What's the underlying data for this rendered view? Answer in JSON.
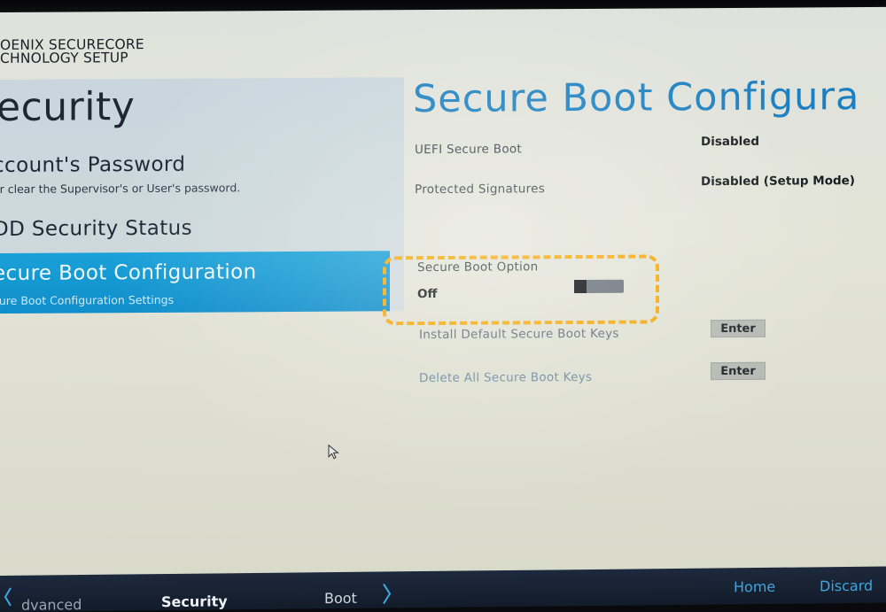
{
  "brand": {
    "line1": "OENIX SECURECORE",
    "line2": "CHNOLOGY SETUP"
  },
  "left_panel": {
    "title": "ecurity",
    "items": [
      {
        "label": "ccount's Password",
        "description": "or clear the Supervisor's or User's password."
      },
      {
        "label": "DD Security Status",
        "description": ""
      },
      {
        "label": "ecure Boot Configuration",
        "description": "cure Boot Configuration Settings",
        "selected": true
      }
    ]
  },
  "content": {
    "title": "Secure Boot Configura",
    "rows": [
      {
        "label": "UEFI Secure Boot",
        "value": "Disabled"
      },
      {
        "label": "Protected Signatures",
        "value": "Disabled (Setup Mode)"
      }
    ],
    "secure_boot_option": {
      "label": "Secure Boot Option",
      "value": "Off",
      "toggle_state": "off"
    },
    "actions": [
      {
        "label": "Install Default Secure Boot Keys",
        "button": "Enter"
      },
      {
        "label": "Delete All Secure Boot Keys",
        "button": "Enter"
      }
    ]
  },
  "bottom_nav": {
    "items": [
      "dvanced",
      "Security",
      "Boot"
    ],
    "right_items": [
      "Home",
      "Discard"
    ]
  },
  "colors": {
    "accent_blue": "#1a7fc0",
    "selected_bg": "#0f8ecb",
    "highlight": "#f5a90a"
  }
}
